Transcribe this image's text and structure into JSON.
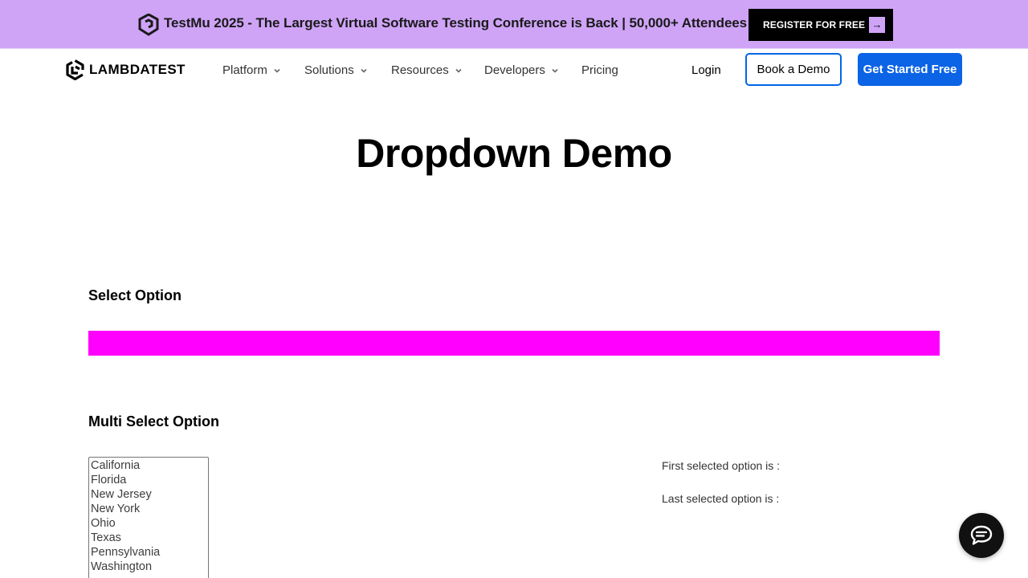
{
  "promo": {
    "text": "TestMu 2025 - The Largest Virtual Software Testing Conference is Back | 50,000+ Attendees",
    "button_label": "REGISTER FOR FREE",
    "button_icon": "arrow-right-icon",
    "background": "#cfa4f7"
  },
  "header": {
    "brand": "LAMBDATEST",
    "nav": [
      {
        "label": "Platform",
        "has_menu": true
      },
      {
        "label": "Solutions",
        "has_menu": true
      },
      {
        "label": "Resources",
        "has_menu": true
      },
      {
        "label": "Developers",
        "has_menu": true
      },
      {
        "label": "Pricing",
        "has_menu": false
      }
    ],
    "login": "Login",
    "book_demo": "Book a Demo",
    "get_started": "Get Started Free",
    "accent": "#0b63e5"
  },
  "main": {
    "title": "Dropdown Demo",
    "select_section": {
      "title": "Select Option",
      "bar_color": "#ff00ff"
    },
    "multi_section": {
      "title": "Multi Select Option",
      "options": [
        "California",
        "Florida",
        "New Jersey",
        "New York",
        "Ohio",
        "Texas",
        "Pennsylvania",
        "Washington"
      ],
      "first_selected_label": "First selected option is :",
      "last_selected_label": "Last selected option is :"
    }
  },
  "chat_widget": {
    "icon": "chat-bubble-icon"
  }
}
